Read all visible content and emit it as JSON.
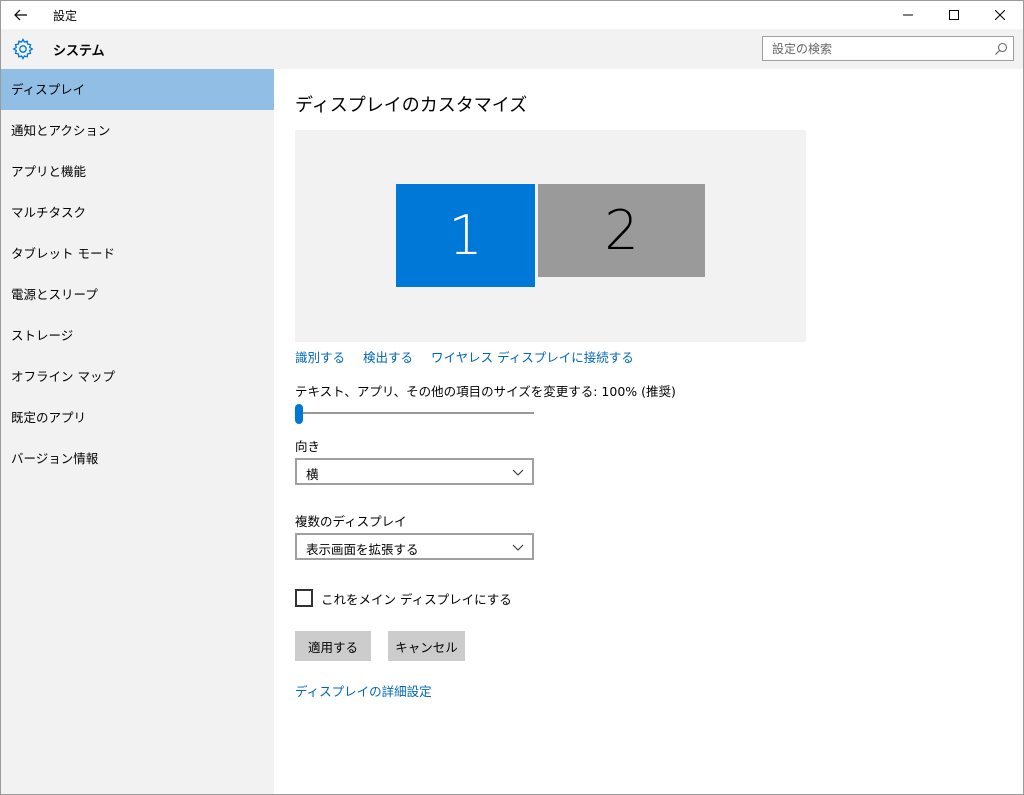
{
  "window": {
    "app_title": "設定",
    "back_icon": "back-arrow-icon",
    "minimize_icon": "minimize-icon",
    "maximize_icon": "maximize-icon",
    "close_icon": "close-icon"
  },
  "sidebar": {
    "section_icon": "gear-icon",
    "section_title": "システム",
    "items": [
      {
        "label": "ディスプレイ",
        "active": true
      },
      {
        "label": "通知とアクション",
        "active": false
      },
      {
        "label": "アプリと機能",
        "active": false
      },
      {
        "label": "マルチタスク",
        "active": false
      },
      {
        "label": "タブレット モード",
        "active": false
      },
      {
        "label": "電源とスリープ",
        "active": false
      },
      {
        "label": "ストレージ",
        "active": false
      },
      {
        "label": "オフライン マップ",
        "active": false
      },
      {
        "label": "既定のアプリ",
        "active": false
      },
      {
        "label": "バージョン情報",
        "active": false
      }
    ]
  },
  "search": {
    "placeholder": "設定の検索",
    "icon": "search-icon"
  },
  "main": {
    "title": "ディスプレイのカスタマイズ",
    "monitors": [
      {
        "label": "1",
        "color": "#0078d7",
        "selected": true
      },
      {
        "label": "2",
        "color": "#9a9a9a",
        "selected": false
      }
    ],
    "links": {
      "identify": "識別する",
      "detect": "検出する",
      "wireless": "ワイヤレス ディスプレイに接続する"
    },
    "scale": {
      "label": "テキスト、アプリ、その他の項目のサイズを変更する: 100% (推奨)",
      "slider_fraction": 0
    },
    "orientation": {
      "label": "向き",
      "value": "横"
    },
    "multiple_displays": {
      "label": "複数のディスプレイ",
      "value": "表示画面を拡張する"
    },
    "main_display_checkbox": {
      "label": "これをメイン ディスプレイにする",
      "checked": false
    },
    "buttons": {
      "apply": "適用する",
      "cancel": "キャンセル"
    },
    "advanced_link": "ディスプレイの詳細設定"
  },
  "colors": {
    "accent": "#0078d7",
    "link": "#0067b8",
    "sidebar_bg": "#f2f2f2",
    "active_item_bg": "#91bee4"
  }
}
